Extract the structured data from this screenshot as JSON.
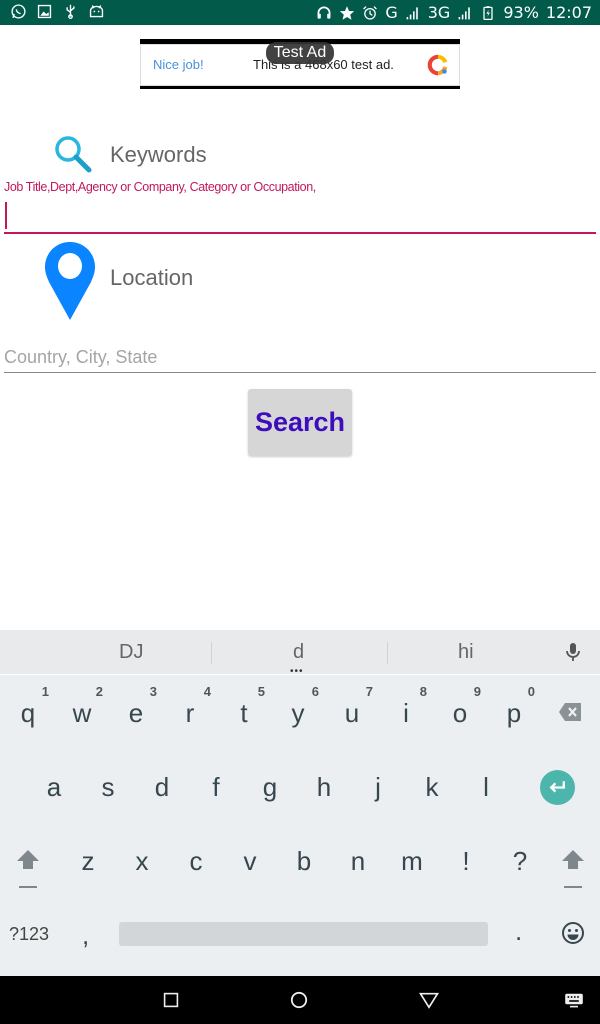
{
  "status_bar": {
    "left_icons": [
      "whatsapp-icon",
      "image-icon",
      "usb-icon",
      "android-debug-icon"
    ],
    "right_icons": [
      "headset-icon",
      "star-icon",
      "alarm-icon",
      "signal-icon",
      "battery-icon"
    ],
    "network_g": "G",
    "network_3g": "3G",
    "battery": "93%",
    "time": "12:07"
  },
  "ad": {
    "badge": "Test Ad",
    "nice": "Nice job!",
    "text": "This is a 468x60 test ad."
  },
  "keywords": {
    "label": "Keywords",
    "hint": "Job Title,Dept,Agency or Company, Category or Occupation,",
    "value": ""
  },
  "location": {
    "label": "Location",
    "placeholder": "Country, City, State",
    "value": ""
  },
  "search_button": "Search",
  "colors": {
    "status_bar": "#025a4a",
    "accent": "#c2185b",
    "search_text": "#3d0cbd",
    "pin": "#0a84ff",
    "magnifier": "#29b6e0",
    "enter_key": "#4db6ac"
  },
  "keyboard": {
    "suggestions": [
      "DJ",
      "d",
      "hi"
    ],
    "row1": [
      {
        "key": "q",
        "hint": "1"
      },
      {
        "key": "w",
        "hint": "2"
      },
      {
        "key": "e",
        "hint": "3"
      },
      {
        "key": "r",
        "hint": "4"
      },
      {
        "key": "t",
        "hint": "5"
      },
      {
        "key": "y",
        "hint": "6"
      },
      {
        "key": "u",
        "hint": "7"
      },
      {
        "key": "i",
        "hint": "8"
      },
      {
        "key": "o",
        "hint": "9"
      },
      {
        "key": "p",
        "hint": "0"
      }
    ],
    "row2": [
      "a",
      "s",
      "d",
      "f",
      "g",
      "h",
      "j",
      "k",
      "l"
    ],
    "row3": [
      "z",
      "x",
      "c",
      "v",
      "b",
      "n",
      "m",
      "!",
      "?"
    ],
    "symbols": "?123",
    "comma": ",",
    "period": "."
  }
}
